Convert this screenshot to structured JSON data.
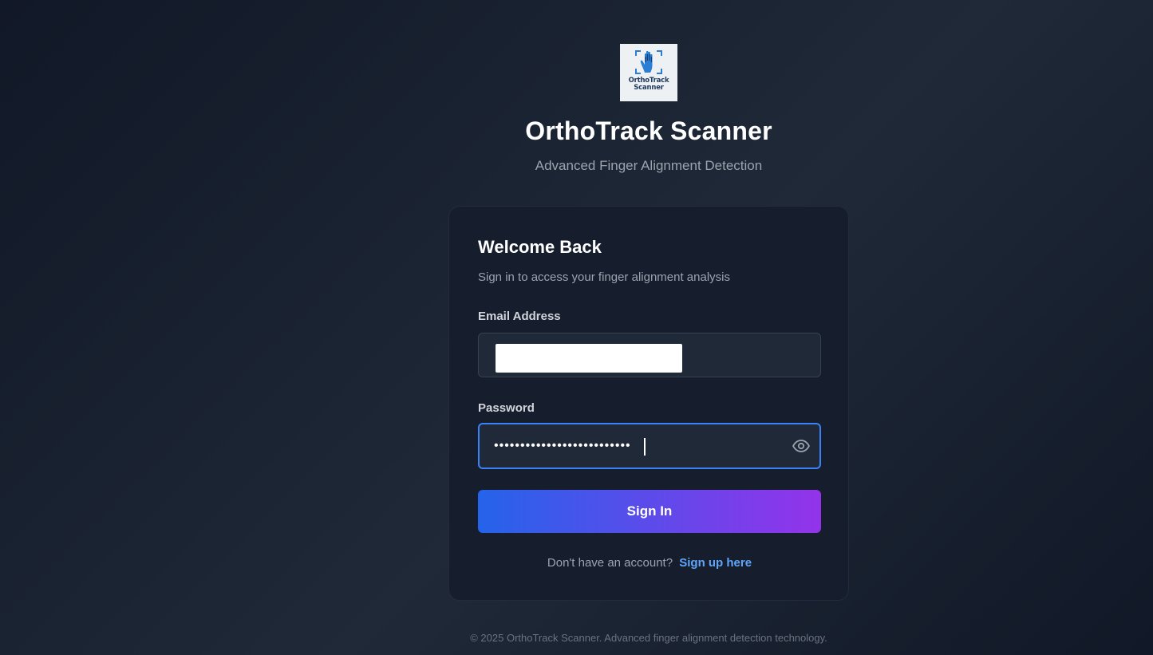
{
  "brand": {
    "logo_text_line1": "OrthoTrack",
    "logo_text_line2": "Scanner",
    "logo_icon": "hand-scan-icon",
    "title": "OrthoTrack Scanner",
    "subtitle": "Advanced Finger Alignment Detection"
  },
  "login": {
    "heading": "Welcome Back",
    "subheading": "Sign in to access your finger alignment analysis",
    "email_label": "Email Address",
    "email_value": "",
    "password_label": "Password",
    "password_value": "••••••••••••••••••••••••••",
    "show_password_icon": "eye-icon",
    "submit_label": "Sign In",
    "signup_prompt": "Don't have an account?",
    "signup_link": "Sign up here"
  },
  "footer": {
    "text": "© 2025 OrthoTrack Scanner. Advanced finger alignment detection technology."
  },
  "colors": {
    "accent_start": "#2563eb",
    "accent_end": "#9333ea",
    "focus_ring": "#3b82f6",
    "link": "#60a5fa"
  }
}
